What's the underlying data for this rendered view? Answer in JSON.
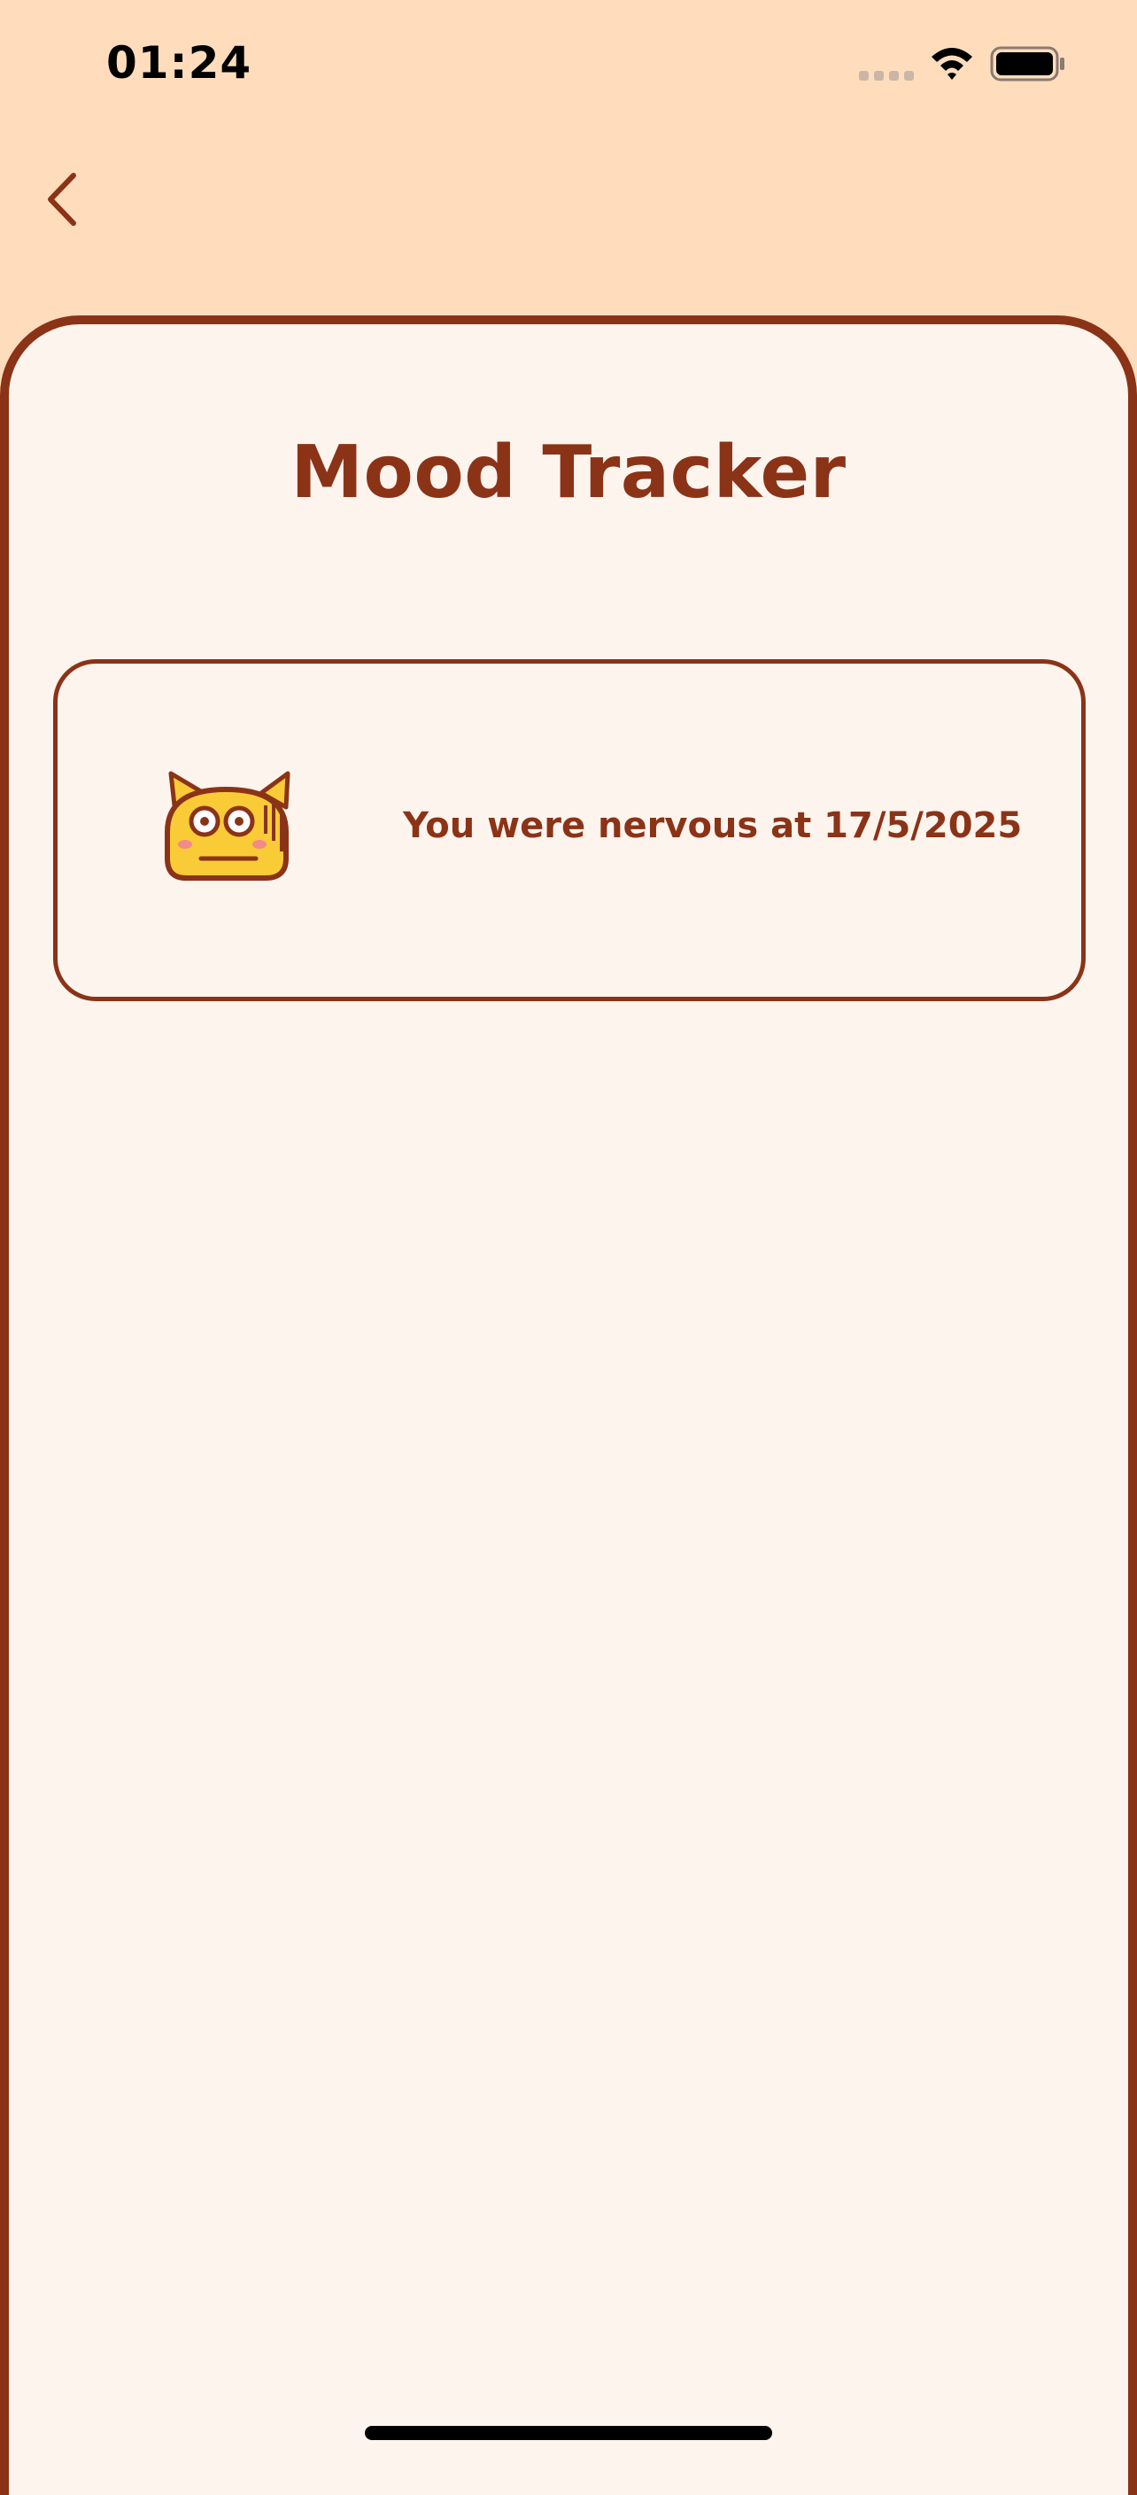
{
  "status_bar": {
    "time": "01:24",
    "signal_icon": "cellular-signal-icon",
    "wifi_icon": "wifi-icon",
    "battery_icon": "battery-full-icon"
  },
  "nav": {
    "back_icon": "chevron-left-icon"
  },
  "page": {
    "title": "Mood Tracker"
  },
  "mood_entries": [
    {
      "icon": "nervous-cat-face-icon",
      "text": "You were nervous at 17/5/2025"
    }
  ],
  "colors": {
    "header_background": "#FFDDBC",
    "sheet_background": "#FDF4EE",
    "accent": "#8B3317",
    "emoji_face": "#F9CB36"
  }
}
